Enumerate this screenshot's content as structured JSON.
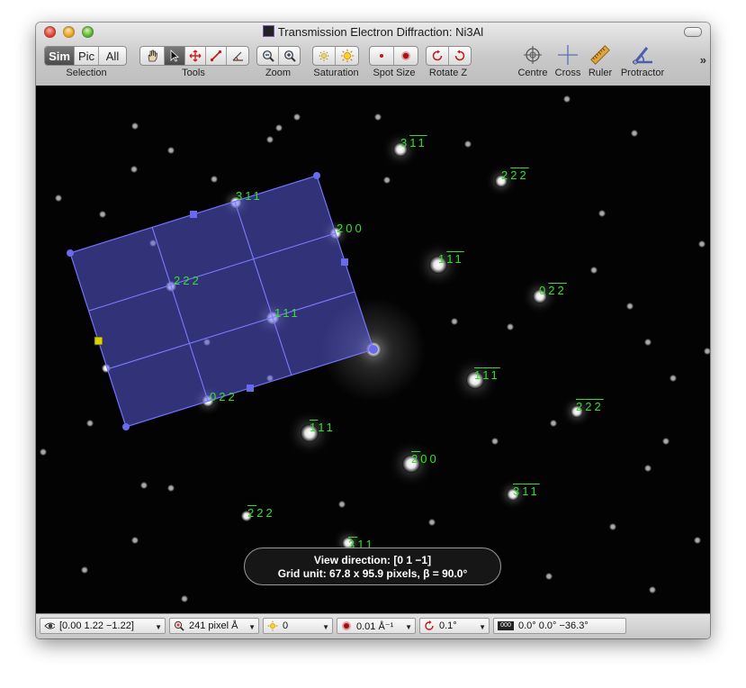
{
  "window": {
    "title": "Transmission Electron Diffraction: Ni3Al"
  },
  "toolbar": {
    "selection": {
      "items": [
        "Sim",
        "Pic",
        "All"
      ],
      "selected": "Sim",
      "label": "Selection"
    },
    "tools": {
      "label": "Tools"
    },
    "zoom": {
      "label": "Zoom"
    },
    "saturation": {
      "label": "Saturation"
    },
    "spot_size": {
      "label": "Spot Size"
    },
    "rotate_z": {
      "label": "Rotate Z"
    },
    "centre": {
      "label": "Centre"
    },
    "cross": {
      "label": "Cross"
    },
    "ruler": {
      "label": "Ruler"
    },
    "protractor": {
      "label": "Protractor"
    },
    "more": "»"
  },
  "labels": [
    {
      "id": "l1",
      "parts": [
        [
          "3",
          0
        ],
        [
          "1",
          1
        ],
        [
          "1",
          1
        ]
      ]
    },
    {
      "id": "l2",
      "parts": [
        [
          "2",
          0
        ],
        [
          "2",
          1
        ],
        [
          "2",
          1
        ]
      ]
    },
    {
      "id": "l3",
      "parts": [
        [
          "3",
          0
        ],
        [
          "1",
          0
        ],
        [
          "1",
          0
        ]
      ]
    },
    {
      "id": "l4",
      "parts": [
        [
          "2",
          0
        ],
        [
          "0",
          0
        ],
        [
          "0",
          0
        ]
      ]
    },
    {
      "id": "l5",
      "parts": [
        [
          "1",
          0
        ],
        [
          "1",
          1
        ],
        [
          "1",
          1
        ]
      ]
    },
    {
      "id": "l6",
      "parts": [
        [
          "0",
          0
        ],
        [
          "2",
          1
        ],
        [
          "2",
          1
        ]
      ]
    },
    {
      "id": "l7",
      "parts": [
        [
          "2",
          0
        ],
        [
          "2",
          0
        ],
        [
          "2",
          0
        ]
      ]
    },
    {
      "id": "l8",
      "parts": [
        [
          "1",
          0
        ],
        [
          "1",
          0
        ],
        [
          "1",
          0
        ]
      ]
    },
    {
      "id": "l9",
      "parts": [
        [
          "1",
          1
        ],
        [
          "1",
          1
        ],
        [
          "1",
          1
        ]
      ]
    },
    {
      "id": "l10",
      "parts": [
        [
          "2",
          1
        ],
        [
          "2",
          1
        ],
        [
          "2",
          1
        ]
      ]
    },
    {
      "id": "l11",
      "parts": [
        [
          "0",
          0
        ],
        [
          "2",
          0
        ],
        [
          "2",
          0
        ]
      ]
    },
    {
      "id": "l12",
      "parts": [
        [
          "1",
          1
        ],
        [
          "1",
          0
        ],
        [
          "1",
          0
        ]
      ]
    },
    {
      "id": "l13",
      "parts": [
        [
          "2",
          1
        ],
        [
          "0",
          0
        ],
        [
          "0",
          0
        ]
      ]
    },
    {
      "id": "l14",
      "parts": [
        [
          "3",
          1
        ],
        [
          "1",
          1
        ],
        [
          "1",
          1
        ]
      ]
    },
    {
      "id": "l15",
      "parts": [
        [
          "2",
          1
        ],
        [
          "2",
          0
        ],
        [
          "2",
          0
        ]
      ]
    },
    {
      "id": "l16",
      "parts": [
        [
          "3",
          1
        ],
        [
          "1",
          0
        ],
        [
          "1",
          0
        ]
      ]
    }
  ],
  "hud": {
    "line1": "View direction: [0 1 −1]",
    "line2": "Grid unit: 67.8 x 95.9 pixels, β = 90.0°"
  },
  "status": {
    "view": "[0.00  1.22  −1.22]",
    "zoom": "241 pixel Å",
    "saturation": "0",
    "spot": "0.01 Å⁻¹",
    "rotate": "0.1°",
    "angles": "0.0°  0.0°  −36.3°"
  },
  "colors": {
    "label_green": "#34e02e",
    "grid_blue": "#6a6aff"
  }
}
